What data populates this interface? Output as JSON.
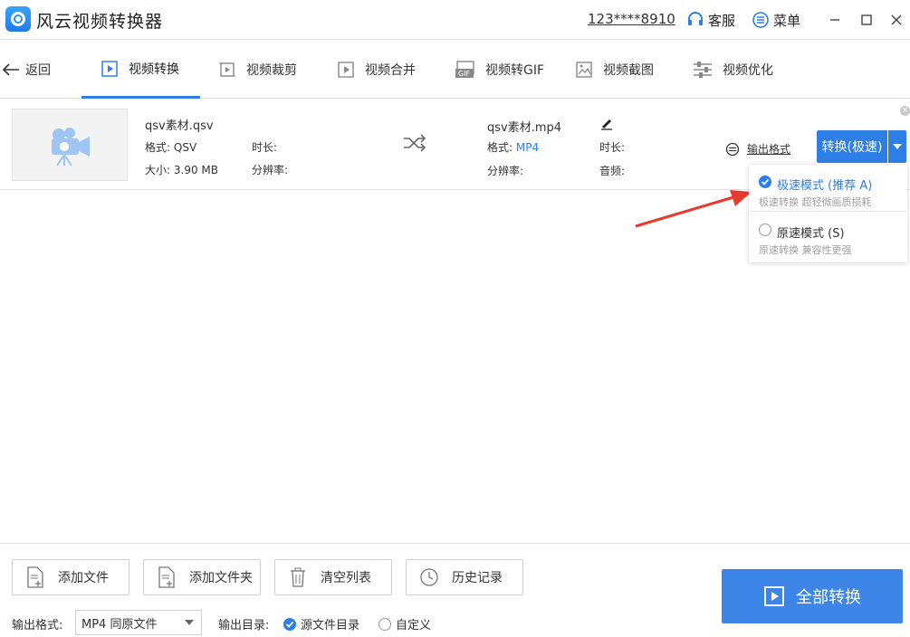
{
  "titlebar": {
    "app_title": "风云视频转换器",
    "account": "123****8910",
    "service_label": "客服",
    "menu_label": "菜单",
    "window_controls": [
      "—",
      "☐",
      "✕"
    ]
  },
  "nav": {
    "back_label": "返回",
    "tabs": [
      {
        "label": "视频转换",
        "active": true,
        "icon": "video-convert-icon"
      },
      {
        "label": "视频裁剪",
        "active": false,
        "icon": "video-crop-icon"
      },
      {
        "label": "视频合并",
        "active": false,
        "icon": "video-merge-icon"
      },
      {
        "label": "视频转GIF",
        "active": false,
        "icon": "gif-icon"
      },
      {
        "label": "视频截图",
        "active": false,
        "icon": "screenshot-icon"
      },
      {
        "label": "视频优化",
        "active": false,
        "icon": "optimize-icon"
      }
    ]
  },
  "file": {
    "source": {
      "name": "qsv素材.qsv",
      "format_label": "格式:",
      "format_value": "QSV",
      "size_label": "大小:",
      "size_value": "3.90 MB",
      "duration_label": "时长:",
      "resolution_label": "分辨率:"
    },
    "target": {
      "name": "qsv素材.mp4",
      "format_label": "格式:",
      "format_value": "MP4",
      "resolution_label": "分辨率:",
      "duration_label": "时长:",
      "audio_label": "音频:"
    },
    "output_format_link": "输出格式",
    "convert_button": "转换(极速)"
  },
  "dropdown": {
    "options": [
      {
        "title": "极速模式 (推荐 A)",
        "desc": "极速转换 超轻微画质损耗",
        "selected": true
      },
      {
        "title": "原速模式 (S)",
        "desc": "原速转换 兼容性更强",
        "selected": false
      }
    ]
  },
  "bottom": {
    "buttons": [
      "添加文件",
      "添加文件夹",
      "清空列表",
      "历史记录"
    ],
    "output_format_label": "输出格式:",
    "output_format_value": "MP4 同原文件",
    "output_dir_label": "输出目录:",
    "dir_options": [
      {
        "label": "源文件目录",
        "selected": true
      },
      {
        "label": "自定义",
        "selected": false
      }
    ],
    "convert_all": "全部转换"
  },
  "colors": {
    "accent": "#2d7fe6",
    "arrow": "#e8392e"
  }
}
